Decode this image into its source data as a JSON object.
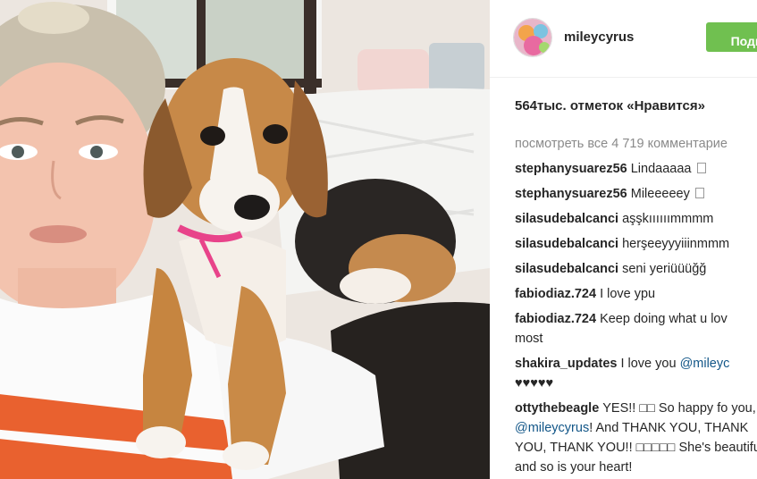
{
  "post": {
    "username": "mileycyrus",
    "follow_label": "Подп",
    "likes": "564тыс. отметок «Нравится»",
    "view_all": "посмотреть все 4 719 комментарие"
  },
  "comments": [
    {
      "user": "stephanysuarez56",
      "text": "Lindaaaaa",
      "glyph": true
    },
    {
      "user": "stephanysuarez56",
      "text": "Mileeeeey",
      "glyph": true
    },
    {
      "user": "silasudebalcanci",
      "text": "aşşkıııııımmmm"
    },
    {
      "user": "silasudebalcanci",
      "text": "herşeeyyyiiinmmm"
    },
    {
      "user": "silasudebalcanci",
      "text": "seni yeriüüüğğ"
    },
    {
      "user": "fabiodiaz.724",
      "text": "I love ypu"
    },
    {
      "user": "fabiodiaz.724",
      "text": "Keep doing what u lov",
      "text2": "most"
    },
    {
      "user": "shakira_updates",
      "text": "I love you",
      "mention": "@mileyc",
      "text2": "♥♥♥♥♥"
    },
    {
      "user": "ottythebeagle",
      "text": "YES!! □□ So happy fo you,",
      "mention": "@mileycyrus",
      "text2": "! And THANK YOU, THANK YOU, THANK YOU!! □□□□□ She's beautiful and so is your heart!"
    }
  ],
  "colors": {
    "follow_button": "#70c050",
    "mention": "#125688",
    "muted": "#8a8a8a"
  }
}
